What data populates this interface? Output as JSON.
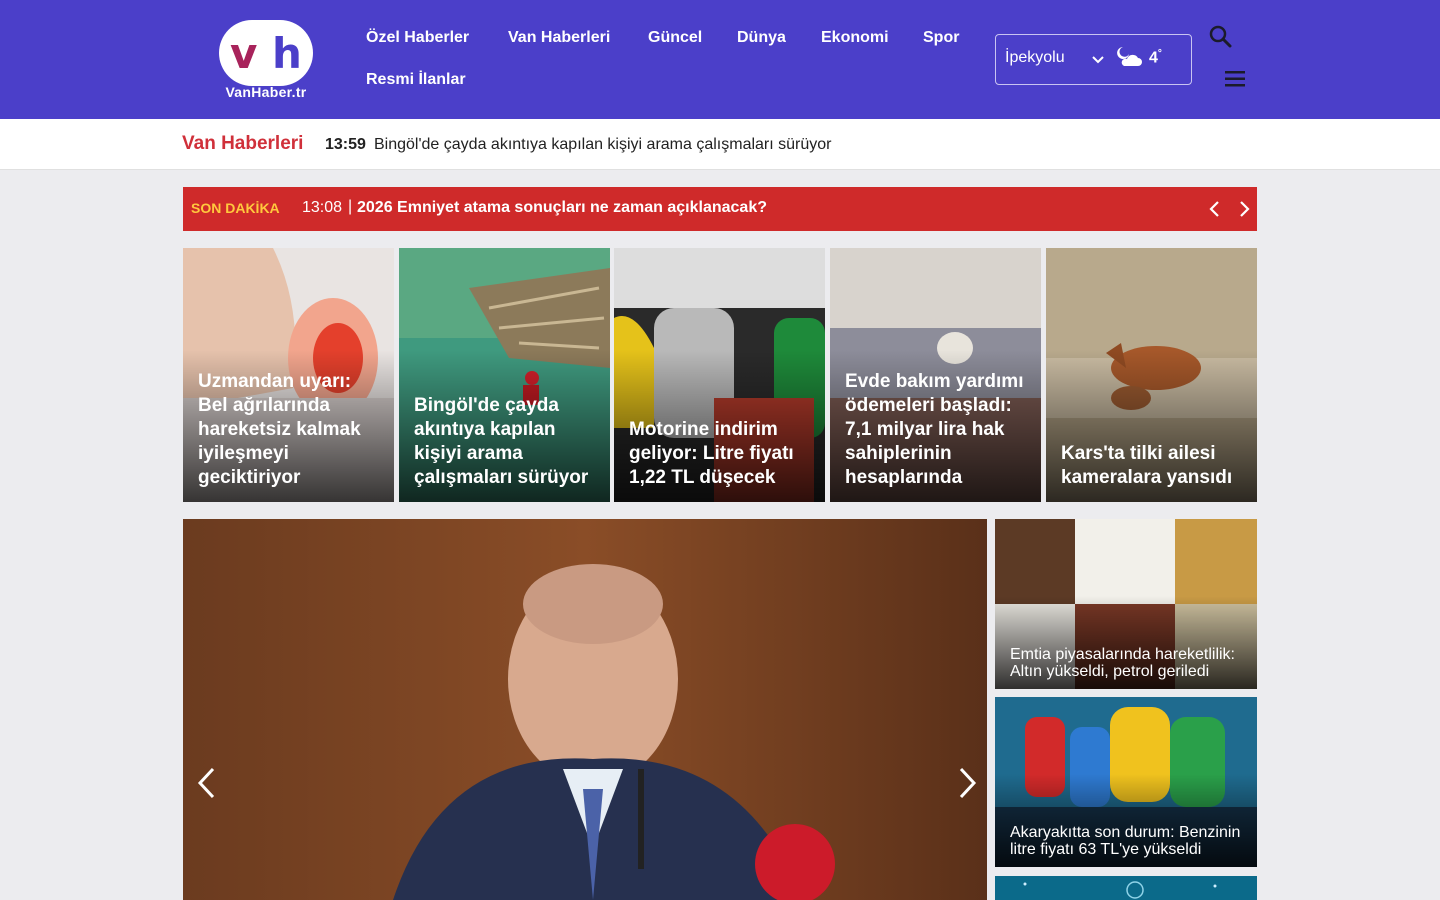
{
  "site": {
    "logo_letters": [
      "v",
      "h"
    ],
    "logo_text": "VanHaber.tr"
  },
  "nav": {
    "items": [
      "Özel Haberler",
      "Van Haberleri",
      "Güncel",
      "Dünya",
      "Ekonomi",
      "Spor",
      "Resmi İlanlar"
    ]
  },
  "weather": {
    "location": "İpekyolu",
    "temperature": "4",
    "unit_symbol": "°",
    "icon": "cloud-moon-icon"
  },
  "ticker": {
    "label": "Van Haberleri",
    "time": "13:59",
    "text": "Bingöl'de çayda akıntıya kapılan kişiyi arama çalışmaları sürüyor"
  },
  "breaking": {
    "label": "SON DAKİKA",
    "time": "13:08",
    "separator": "|",
    "text": "2026 Emniyet atama sonuçları ne zaman açıklanacak?"
  },
  "cards": [
    {
      "title": "Uzmandan uyarı: Bel ağrılarında hareketsiz kalmak iyileşmeyi geciktiriyor"
    },
    {
      "title": "Bingöl'de çayda akıntıya kapılan kişiyi arama çalışmaları sürüyor"
    },
    {
      "title": "Motorine indirim geliyor: Litre fiyatı 1,22 TL düşecek"
    },
    {
      "title": "Evde bakım yardımı ödemeleri başladı: 7,1 milyar lira hak sahiplerinin hesaplarında"
    },
    {
      "title": "Kars'ta tilki ailesi kameralara yansıdı"
    }
  ],
  "side_stories": [
    {
      "title": "Emtia piyasalarında hareketlilik: Altın yükseldi, petrol geriledi"
    },
    {
      "title": "Akaryakıtta son durum: Benzinin litre fiyatı 63 TL'ye yükseldi"
    }
  ],
  "colors": {
    "header_bg": "#4b3fc9",
    "breaking_bg": "#cf2a2a",
    "breaking_label": "#ffc83d",
    "ticker_label": "#d0303a"
  }
}
